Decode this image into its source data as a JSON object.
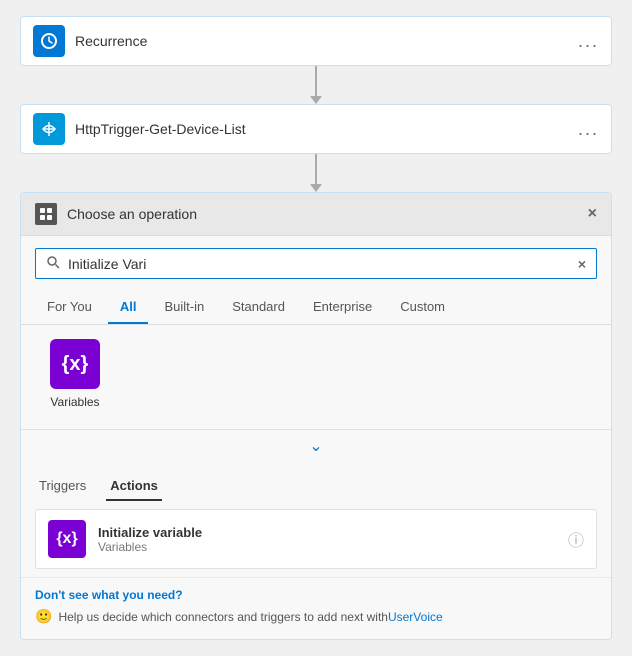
{
  "cards": {
    "recurrence": {
      "title": "Recurrence",
      "icon_text": "⏱",
      "menu_label": "..."
    },
    "http": {
      "title": "HttpTrigger-Get-Device-List",
      "icon_text": "⚡",
      "menu_label": "..."
    }
  },
  "operation_panel": {
    "header_title": "Choose an operation",
    "close_label": "×",
    "search_value": "Initialize Vari",
    "search_placeholder": "Initialize Vari",
    "clear_label": "×"
  },
  "tabs": [
    {
      "id": "for-you",
      "label": "For You",
      "active": false
    },
    {
      "id": "all",
      "label": "All",
      "active": true
    },
    {
      "id": "built-in",
      "label": "Built-in",
      "active": false
    },
    {
      "id": "standard",
      "label": "Standard",
      "active": false
    },
    {
      "id": "enterprise",
      "label": "Enterprise",
      "active": false
    },
    {
      "id": "custom",
      "label": "Custom",
      "active": false
    }
  ],
  "connectors": [
    {
      "name": "Variables",
      "logo_text": "{x}"
    }
  ],
  "sub_tabs": [
    {
      "id": "triggers",
      "label": "Triggers",
      "active": false
    },
    {
      "id": "actions",
      "label": "Actions",
      "active": true
    }
  ],
  "actions": [
    {
      "title": "Initialize variable",
      "subtitle": "Variables",
      "logo_text": "{x}"
    }
  ],
  "footer": {
    "dont_see": "Don't see what you need?",
    "help_prefix": "Help us decide which connectors and triggers to add next with ",
    "help_link_text": "UserVoice"
  }
}
